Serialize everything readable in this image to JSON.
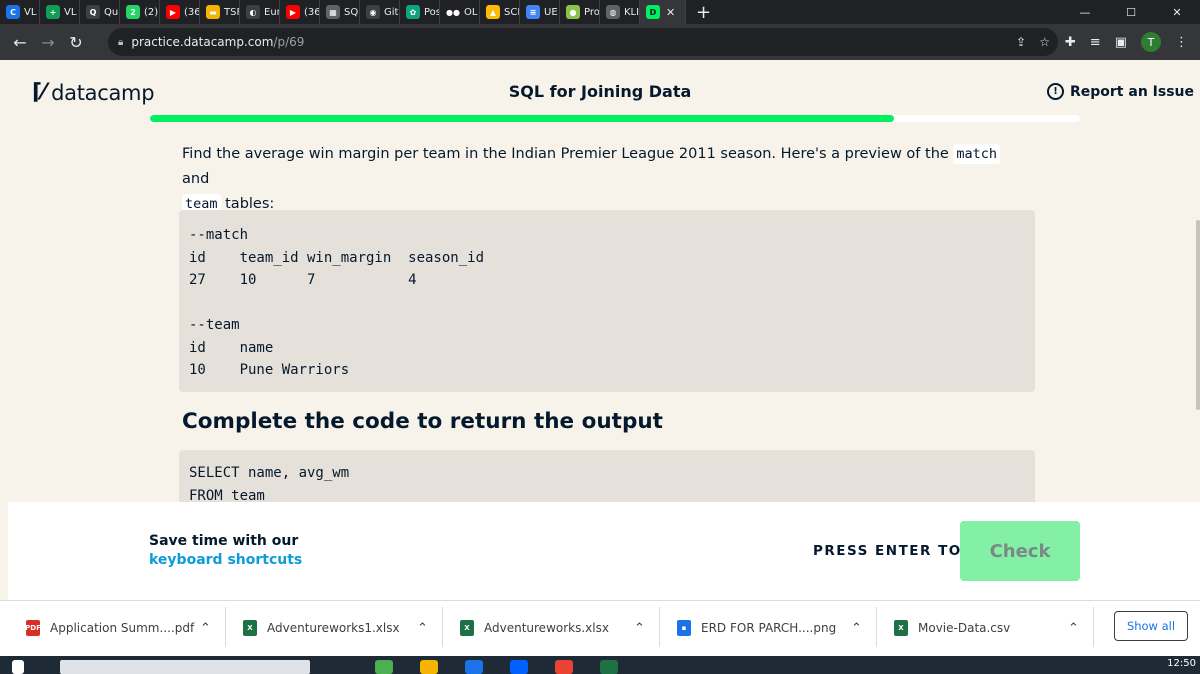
{
  "browser": {
    "tabs": [
      {
        "label": "VL",
        "color": "#1a73e8",
        "glyph": "C"
      },
      {
        "label": "VL",
        "color": "#0f9d58",
        "glyph": "+"
      },
      {
        "label": "Qu",
        "color": "#3c4043",
        "glyph": "Q"
      },
      {
        "label": "(2)",
        "color": "#25d366",
        "glyph": "2"
      },
      {
        "label": "(36",
        "color": "#ff0000",
        "glyph": "▶"
      },
      {
        "label": "TSF",
        "color": "#f4b400",
        "glyph": "▬"
      },
      {
        "label": "Eur",
        "color": "#3c4043",
        "glyph": "◐"
      },
      {
        "label": "(36",
        "color": "#ff0000",
        "glyph": "▶"
      },
      {
        "label": "SQ",
        "color": "#5f6368",
        "glyph": "▦"
      },
      {
        "label": "Git",
        "color": "#3c4043",
        "glyph": "◉"
      },
      {
        "label": "Pos",
        "color": "#10a37f",
        "glyph": "✿"
      },
      {
        "label": "OL",
        "color": "#202124",
        "glyph": "●●"
      },
      {
        "label": "SCI",
        "color": "#fbbc04",
        "glyph": "▲"
      },
      {
        "label": "UE",
        "color": "#4285f4",
        "glyph": "≡"
      },
      {
        "label": "Pro",
        "color": "#8bc34a",
        "glyph": "●"
      },
      {
        "label": "KLI",
        "color": "#5f6368",
        "glyph": "◍"
      }
    ],
    "active_tab_color": "#03ef62",
    "url_host": "practice.datacamp.com",
    "url_path": "/p/69"
  },
  "header": {
    "logo_text": "datacamp",
    "course_title": "SQL for Joining Data",
    "report_label": "Report an Issue",
    "progress_fraction": 0.8
  },
  "exercise": {
    "prompt_before": "Find the average win margin per team in the Indian Premier League 2011 season. Here's a preview of the ",
    "code_match": "match",
    "prompt_and": " and",
    "code_team": "team",
    "prompt_after": " tables:",
    "preview_code": "--match\nid    team_id win_margin  season_id\n27    10      7           4\n\n--team\nid    name\n10    Pune Warriors",
    "section_heading": "Complete the code to return the output",
    "answer_code": "SELECT name, avg_wm\nFROM team"
  },
  "actionbar": {
    "shortcuts_line1": "Save time with our",
    "shortcuts_link": "keyboard shortcuts",
    "press_enter": "PRESS ENTER TO",
    "check_label": "Check"
  },
  "downloads": {
    "items": [
      {
        "name": "Application Summ....pdf",
        "type": "pdf"
      },
      {
        "name": "Adventureworks1.xlsx",
        "type": "xlsx"
      },
      {
        "name": "Adventureworks.xlsx",
        "type": "xlsx"
      },
      {
        "name": "ERD FOR PARCH....png",
        "type": "png"
      },
      {
        "name": "Movie-Data.csv",
        "type": "csv"
      }
    ],
    "show_all_label": "Show all"
  },
  "taskbar": {
    "time": "12:50"
  }
}
